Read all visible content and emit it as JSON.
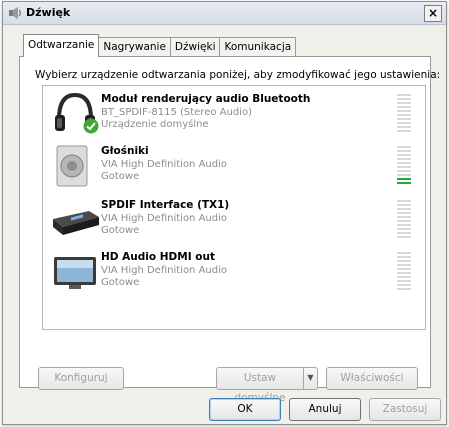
{
  "window": {
    "title": "Dźwięk",
    "close_glyph": "×"
  },
  "tabs": [
    {
      "label": "Odtwarzanie",
      "active": true
    },
    {
      "label": "Nagrywanie",
      "active": false
    },
    {
      "label": "Dźwięki",
      "active": false
    },
    {
      "label": "Komunikacja",
      "active": false
    }
  ],
  "instruction": "Wybierz urządzenie odtwarzania poniżej, aby zmodyfikować jego ustawienia:",
  "devices": [
    {
      "name": "Moduł renderujący audio Bluetooth",
      "description": "BT_SPDIF-8115 (Stereo Audio)",
      "status": "Urządzenie domyślne",
      "icon": "headphones-icon",
      "is_default": true,
      "level": 0
    },
    {
      "name": "Głośniki",
      "description": "VIA High Definition Audio",
      "status": "Gotowe",
      "icon": "speaker-icon",
      "is_default": false,
      "level": 0.2
    },
    {
      "name": "SPDIF Interface (TX1)",
      "description": "VIA High Definition Audio",
      "status": "Gotowe",
      "icon": "spdif-receiver-icon",
      "is_default": false,
      "level": 0
    },
    {
      "name": "HD Audio HDMI out",
      "description": "VIA High Definition Audio",
      "status": "Gotowe",
      "icon": "monitor-icon",
      "is_default": false,
      "level": 0
    }
  ],
  "buttons": {
    "configure": "Konfiguruj",
    "set_default": "Ustaw domyślne",
    "properties": "Właściwości",
    "ok": "OK",
    "cancel": "Anuluj",
    "apply": "Zastosuj"
  },
  "colors": {
    "meter_active": "#2aa43a",
    "meter_idle": "#d7dad7",
    "default_check": "#3fa535"
  }
}
